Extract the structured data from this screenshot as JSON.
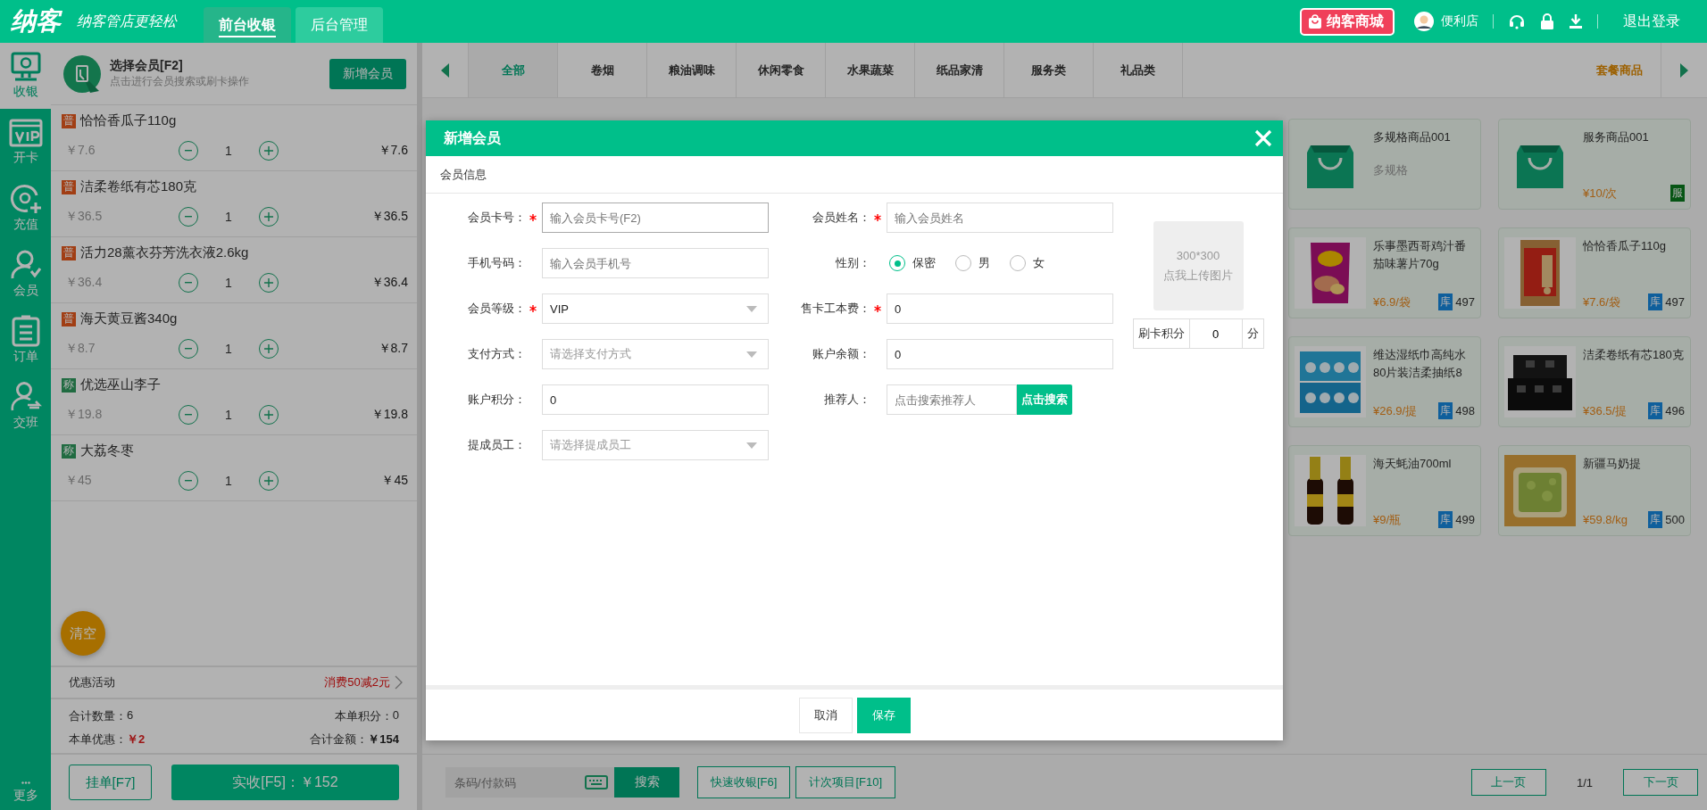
{
  "top_bar": {
    "logo": "纳客",
    "slogan": "纳客管店更轻松",
    "tabs": [
      {
        "label": "前台收银",
        "selected": true
      },
      {
        "label": "后台管理",
        "selected": false
      }
    ],
    "mall_badge": "纳客商城",
    "store_name": "便利店",
    "logout": "退出登录"
  },
  "sidebar": {
    "items": [
      {
        "label": "收银",
        "kind": "cashier",
        "selected": true
      },
      {
        "label": "开卡",
        "kind": "vip",
        "selected": false
      },
      {
        "label": "充值",
        "kind": "recharge",
        "selected": false
      },
      {
        "label": "会员",
        "kind": "member",
        "selected": false
      },
      {
        "label": "订单",
        "kind": "order",
        "selected": false
      },
      {
        "label": "交班",
        "kind": "shift",
        "selected": false
      }
    ],
    "more": "更多"
  },
  "cart": {
    "member": {
      "title": "选择会员[F2]",
      "hint": "点击进行会员搜索或刷卡操作",
      "button": "新增会员"
    },
    "items": [
      {
        "tag": "普",
        "color": "#a23f14",
        "name": "恰恰香瓜子110g",
        "unit_price": "￥7.6",
        "qty": "1",
        "total": "￥7.6"
      },
      {
        "tag": "普",
        "color": "#a23f14",
        "name": "洁柔卷纸有芯180克",
        "unit_price": "￥36.5",
        "qty": "1",
        "total": "￥36.5"
      },
      {
        "tag": "普",
        "color": "#a23f14",
        "name": "活力28薰衣芬芳洗衣液2.6kg",
        "unit_price": "￥36.4",
        "qty": "1",
        "total": "￥36.4"
      },
      {
        "tag": "普",
        "color": "#a23f14",
        "name": "海天黄豆酱340g",
        "unit_price": "￥8.7",
        "qty": "1",
        "total": "￥8.7"
      },
      {
        "tag": "称",
        "color": "#206c42",
        "name": "优选巫山李子",
        "unit_price": "￥19.8",
        "qty": "1",
        "total": "￥19.8"
      },
      {
        "tag": "称",
        "color": "#206c42",
        "name": "大荔冬枣",
        "unit_price": "￥45",
        "qty": "1",
        "total": "￥45"
      }
    ],
    "clear_button": "清空",
    "promo": {
      "label": "优惠活动",
      "value": "消费50减2元"
    },
    "totals": [
      {
        "label": "合计数量：",
        "value": "6",
        "kind": "plain"
      },
      {
        "label": "本单积分：",
        "value": "0",
        "kind": "plain"
      },
      {
        "label": "本单优惠：",
        "value": "￥2",
        "kind": "discount"
      },
      {
        "label": "合计金额：",
        "value": "￥154",
        "kind": "total"
      }
    ],
    "hold_button": "挂单[F7]",
    "pay_button": "实收[F5]：￥152"
  },
  "categories": {
    "items": [
      {
        "label": "全部",
        "selected": true
      },
      {
        "label": "卷烟",
        "selected": false
      },
      {
        "label": "粮油调味",
        "selected": false
      },
      {
        "label": "休闲零食",
        "selected": false
      },
      {
        "label": "水果蔬菜",
        "selected": false
      },
      {
        "label": "纸品家清",
        "selected": false
      },
      {
        "label": "服务类",
        "selected": false
      },
      {
        "label": "礼品类",
        "selected": false
      }
    ],
    "package_label": "套餐商品"
  },
  "products": [
    {
      "kind": "icon",
      "name": "多规格商品001",
      "subtitle": "多规格"
    },
    {
      "kind": "icon",
      "name": "服务商品001",
      "price": "¥10/次",
      "badge": "服"
    },
    {
      "kind": "picture",
      "name": "乐事墨西哥鸡汁番茄味薯片70g",
      "price": "¥6.9/袋",
      "stock_tag": "库",
      "stock": "497"
    },
    {
      "kind": "picture",
      "name": "恰恰香瓜子110g",
      "price": "¥7.6/袋",
      "stock_tag": "库",
      "stock": "497"
    },
    {
      "kind": "picture",
      "name": "维达湿纸巾高纯水80片装洁柔抽纸8",
      "price": "¥26.9/提",
      "stock_tag": "库",
      "stock": "498"
    },
    {
      "kind": "picture",
      "name": "洁柔卷纸有芯180克",
      "price": "¥36.5/提",
      "stock_tag": "库",
      "stock": "496"
    },
    {
      "kind": "picture",
      "name": "海天蚝油700ml",
      "price": "¥9/瓶",
      "stock_tag": "库",
      "stock": "499"
    },
    {
      "kind": "picture",
      "name": "新疆马奶提",
      "price": "¥59.8/kg",
      "stock_tag": "库",
      "stock": "500"
    }
  ],
  "bottom_bar": {
    "barcode_placeholder": "条码/付款码",
    "search_button": "搜索",
    "buttons": [
      "快速收银[F6]",
      "计次项目[F10]"
    ],
    "prev": "上一页",
    "page": "1/1",
    "next": "下一页"
  },
  "modal": {
    "title": "新增会员",
    "section": "会员信息",
    "fields": [
      {
        "label": "会员卡号：",
        "required": true,
        "kind": "text",
        "placeholder": "输入会员卡号(F2)"
      },
      {
        "label": "会员姓名：",
        "required": true,
        "kind": "text",
        "placeholder": "输入会员姓名"
      },
      {
        "label": "手机号码：",
        "required": false,
        "kind": "text",
        "placeholder": "输入会员手机号"
      },
      {
        "label": "性别：",
        "required": false,
        "kind": "radio",
        "options": [
          {
            "label": "保密",
            "selected": true
          },
          {
            "label": "男",
            "selected": false
          },
          {
            "label": "女",
            "selected": false
          }
        ]
      },
      {
        "label": "会员等级：",
        "required": true,
        "kind": "select",
        "value": "VIP"
      },
      {
        "label": "售卡工本费：",
        "required": true,
        "kind": "text",
        "value": "0"
      },
      {
        "label": "支付方式：",
        "required": false,
        "kind": "select",
        "placeholder": "请选择支付方式"
      },
      {
        "label": "账户余额：",
        "required": false,
        "kind": "text",
        "value": "0"
      },
      {
        "label": "账户积分：",
        "required": false,
        "kind": "text",
        "value": "0"
      },
      {
        "label": "推荐人：",
        "required": false,
        "kind": "search",
        "placeholder": "点击搜索推荐人",
        "button": "点击搜索"
      },
      {
        "label": "提成员工：",
        "required": false,
        "kind": "select",
        "placeholder": "请选择提成员工"
      }
    ],
    "upload": {
      "size": "300*300",
      "hint": "点我上传图片"
    },
    "points": {
      "label": "刷卡积分",
      "value": "0",
      "unit": "分"
    },
    "cancel": "取消",
    "save": "保存"
  }
}
